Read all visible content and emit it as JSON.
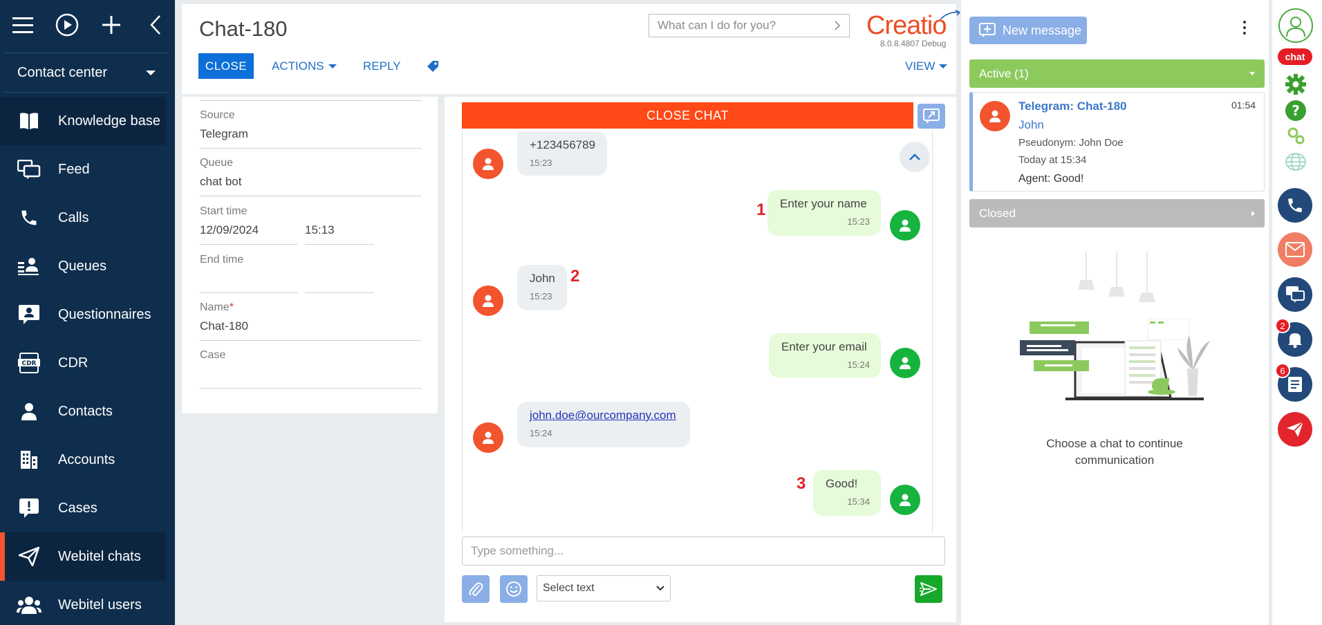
{
  "sidebar": {
    "workplace": "Contact center",
    "items": [
      {
        "label": "Knowledge base",
        "icon": "book-icon"
      },
      {
        "label": "Feed",
        "icon": "feed-icon"
      },
      {
        "label": "Calls",
        "icon": "phone-icon"
      },
      {
        "label": "Queues",
        "icon": "queue-icon"
      },
      {
        "label": "Questionnaires",
        "icon": "questionnaire-icon"
      },
      {
        "label": "CDR",
        "icon": "cdr-icon"
      },
      {
        "label": "Contacts",
        "icon": "contact-icon"
      },
      {
        "label": "Accounts",
        "icon": "building-icon"
      },
      {
        "label": "Cases",
        "icon": "case-icon"
      },
      {
        "label": "Webitel chats",
        "icon": "send-icon"
      },
      {
        "label": "Webitel users",
        "icon": "users-icon"
      }
    ]
  },
  "header": {
    "title": "Chat-180",
    "search_placeholder": "What can I do for you?",
    "logo": "Creatio",
    "version": "8.0.8.4807 Debug",
    "close_label": "CLOSE",
    "actions_label": "ACTIONS",
    "reply_label": "REPLY",
    "view_label": "VIEW"
  },
  "details": {
    "source_label": "Source",
    "source_value": "Telegram",
    "queue_label": "Queue",
    "queue_value": "chat bot",
    "start_label": "Start time",
    "start_date": "12/09/2024",
    "start_time": "15:13",
    "end_label": "End time",
    "end_date": "",
    "end_time": "",
    "name_label": "Name",
    "name_required": "*",
    "name_value": "Chat-180",
    "case_label": "Case",
    "case_value": ""
  },
  "chat": {
    "close_chat_label": "CLOSE CHAT",
    "messages": [
      {
        "text": "+123456789",
        "time": "15:23",
        "side": "in"
      },
      {
        "text": "Enter your name",
        "time": "15:23",
        "side": "out",
        "step": "1"
      },
      {
        "text": "John",
        "time": "15:23",
        "side": "in",
        "step": "2"
      },
      {
        "text": "Enter your email",
        "time": "15:24",
        "side": "out"
      },
      {
        "text": "john.doe@ourcompany.com",
        "time": "15:24",
        "side": "in"
      },
      {
        "text": "Good!",
        "time": "15:34",
        "side": "out",
        "step": "3"
      }
    ],
    "input_placeholder": "Type something...",
    "select_label": "Select text"
  },
  "panel": {
    "new_message_label": "New message",
    "active_label": "Active (1)",
    "closed_label": "Closed",
    "card": {
      "title": "Telegram: Chat-180",
      "time": "01:54",
      "name": "John",
      "pseudonym": "Pseudonym: John Doe",
      "date": "Today at 15:34",
      "last_message": "Agent: Good!"
    },
    "empty_text": "Choose a chat to continue communication"
  },
  "rightbar": {
    "chat_badge": "chat",
    "notifications_count": "2",
    "tasks_count": "6"
  },
  "colors": {
    "sidebar_bg": "#0f2e4d",
    "accent_orange": "#f2542d",
    "primary_blue": "#0d6fd8",
    "agent_green": "#16b33e",
    "active_green": "#8dca5e"
  }
}
